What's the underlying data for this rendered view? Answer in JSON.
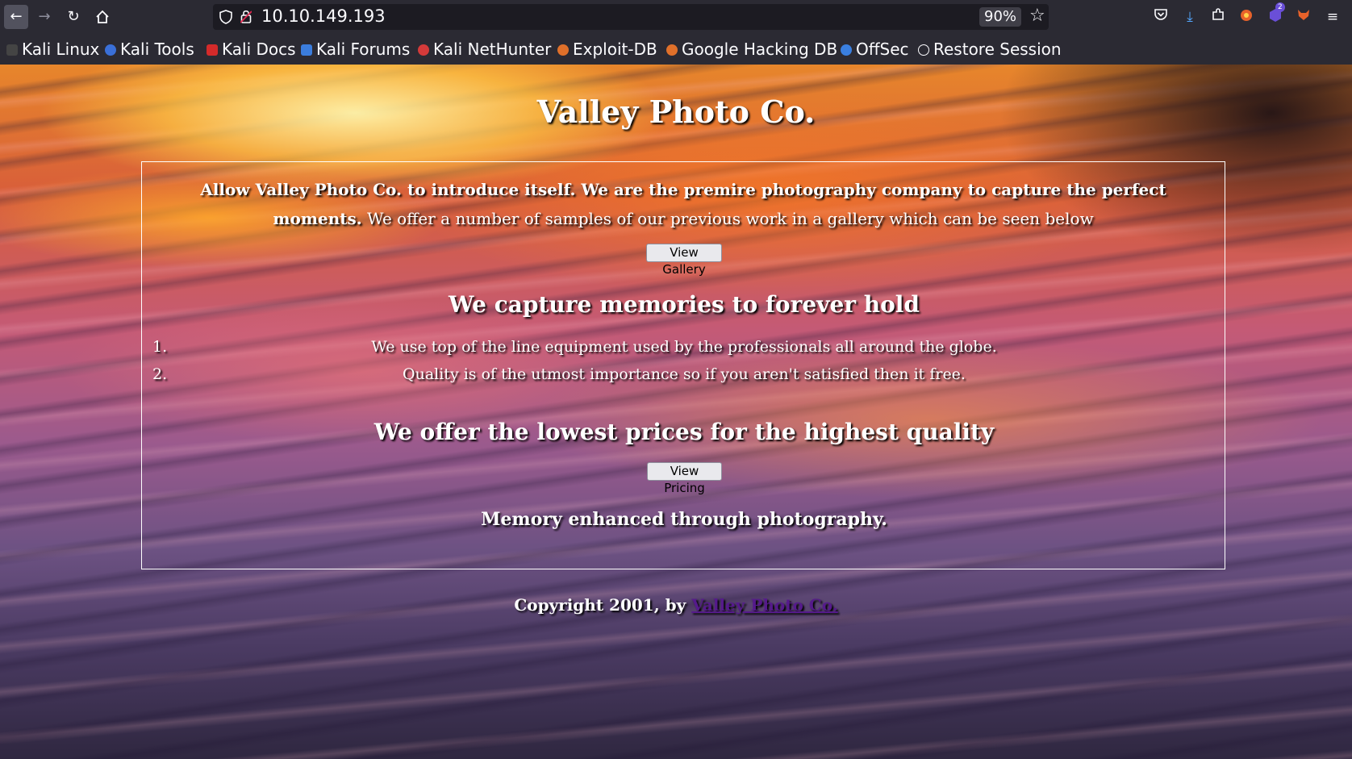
{
  "browser": {
    "url": "10.10.149.193",
    "zoom": "90%",
    "extension_badge": "2"
  },
  "bookmarks": [
    {
      "label": "Kali Linux",
      "color": "#2f2f2f"
    },
    {
      "label": "Kali Tools",
      "color": "#3a6fd8"
    },
    {
      "label": "Kali Docs",
      "color": "#d42a2a"
    },
    {
      "label": "Kali Forums",
      "color": "#3b7ddd"
    },
    {
      "label": "Kali NetHunter",
      "color": "#d43a3a"
    },
    {
      "label": "Exploit-DB",
      "color": "#e0702a"
    },
    {
      "label": "Google Hacking DB",
      "color": "#e0702a"
    },
    {
      "label": "OffSec",
      "color": "#3a7fe0"
    },
    {
      "label": "Restore Session",
      "color": "#fbfbfe"
    }
  ],
  "page": {
    "title": "Valley Photo Co.",
    "intro_bold": "Allow Valley Photo Co. to introduce itself. We are the premire photography company to capture the perfect moments.",
    "intro_rest": " We offer a number of samples of our previous work in a gallery which can be seen below",
    "gallery_button": "View Gallery",
    "memories_heading": "We capture memories to forever hold",
    "list": [
      {
        "num": "1.",
        "text": "We use top of the line equipment used by the professionals all around the globe."
      },
      {
        "num": "2.",
        "text": "Quality is of the utmost importance so if you aren't satisfied then it free."
      }
    ],
    "prices_heading": "We offer the lowest prices for the highest quality",
    "pricing_button": "View Pricing",
    "tagline": "Memory enhanced through photography.",
    "footer_text": "Copyright 2001, by ",
    "footer_link": "Valley Photo Co."
  }
}
